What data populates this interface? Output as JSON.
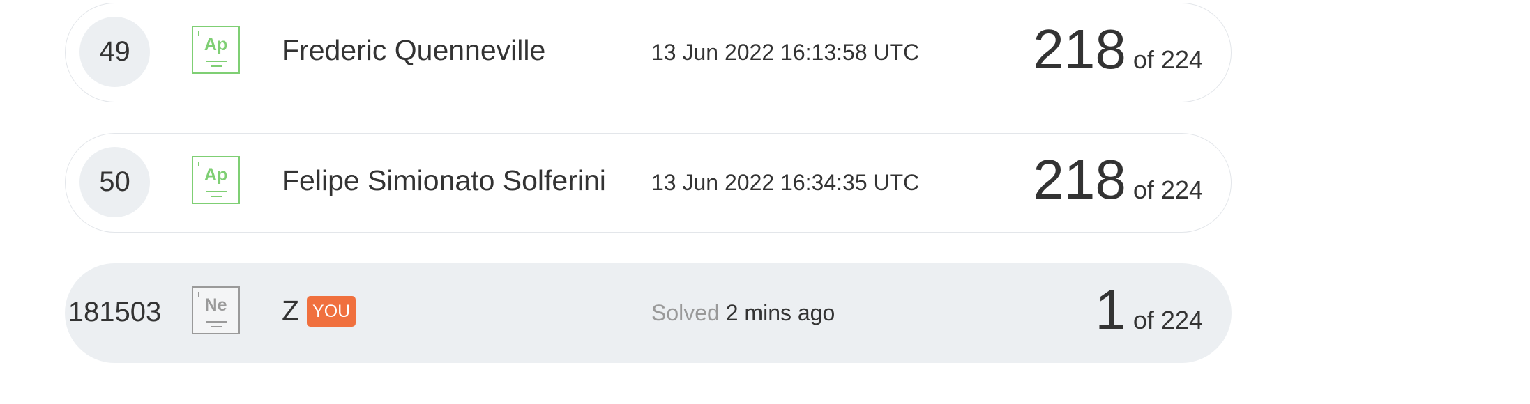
{
  "rows": [
    {
      "rank": "49",
      "level_symbol": "Ap",
      "name": "Frederic Quenneville",
      "date": "13 Jun 2022 16:13:58 UTC",
      "score": "218",
      "of_total": "of 224"
    },
    {
      "rank": "50",
      "level_symbol": "Ap",
      "name": "Felipe Simionato Solferini",
      "date": "13 Jun 2022 16:34:35 UTC",
      "score": "218",
      "of_total": "of 224"
    }
  ],
  "me": {
    "rank": "181503",
    "level_symbol": "Ne",
    "name": "Z",
    "badge": "YOU",
    "solved_label": "Solved",
    "solved_ago": "2 mins ago",
    "score": "1",
    "of_total": "of 224"
  },
  "colors": {
    "level_green": "#7fcf74",
    "level_gray": "#9a9a9a",
    "you_badge": "#f0703e",
    "highlight_row": "#eceff2"
  },
  "icons": {
    "level_badge": "level-badge-icon"
  }
}
